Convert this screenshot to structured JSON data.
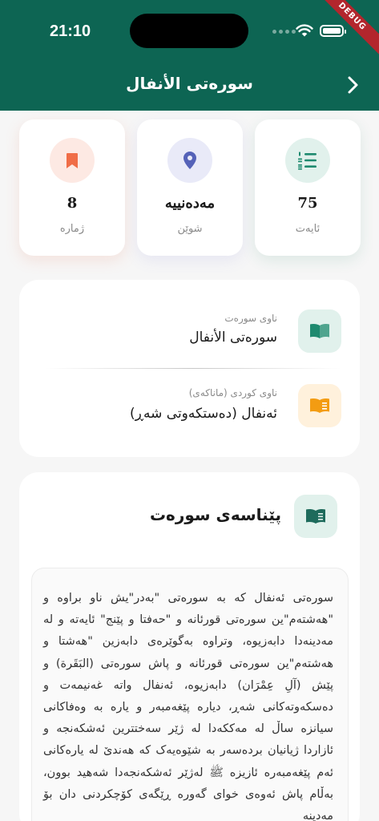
{
  "status_bar": {
    "time": "21:10",
    "debug_banner": "DEBUG"
  },
  "header": {
    "title": "سورەتی الأنفال",
    "back_icon": "chevron-right-icon"
  },
  "stats": [
    {
      "icon": "bookmark-icon",
      "value": "8",
      "label": "ژمارە",
      "accent": "#f06d47",
      "bg": "#fde9e3"
    },
    {
      "icon": "location-pin-icon",
      "value": "مەدەنییە",
      "label": "شوێن",
      "accent": "#5562b8",
      "bg": "#e9eaf8"
    },
    {
      "icon": "list-numbered-icon",
      "value": "75",
      "label": "ئایەت",
      "accent": "#1e8a6f",
      "bg": "#e1f1ec"
    }
  ],
  "names": {
    "surah_name_label": "ناوی سورەت",
    "surah_name_value": "سورەتی الأنفال",
    "kurdish_name_label": "ناوی کوردی (ماناکەی)",
    "kurdish_name_value": "ئەنفال (دەستکەوتی شەڕ)"
  },
  "intro": {
    "title": "پێناسەی سورەت",
    "text": "سورەتی ئەنفال کە بە سورەتی \"بەدر\"یش ناو براوە و \"هەشتەم\"ین سورەتی قورئانە و \"حەفتا و پێنج\" ئایەتە و لە مەدینەدا دابەزیوە، وتراوە بەگوێرەی دابەزین \"هەشتا و هەشتەم\"ین سورەتی قورئانە و پاش سورەتی (البَقَرة) و پێش (آلِ عِمْرَان) دابەزیوە، ئەنفال واتە غەنیمەت و دەسکەوتەکانی شەڕ، دیارە پێغەمبەر و یارە بە وەفاکانی سیانزە ساڵ لە مەککەدا لە ژێر سەختترین ئەشکەنجە و ئازاردا ژیانیان بردەسەر بە شێوەیەک کە هەندێ لە یارەکانی ئەم پێغەمبەرە ئازیزە ﷺ لەژێر ئەشکەنجەدا شەهید بوون، بەڵام پاش ئەوەی خوای گەورە ڕێگەی کۆچکردنی دان بۆ مەدینە"
  },
  "colors": {
    "primary": "#0d6553",
    "intro_icon": "#1e6b5c",
    "surah_name_icon": "#1e8a6f",
    "kurdish_name_icon": "#f39c12"
  }
}
